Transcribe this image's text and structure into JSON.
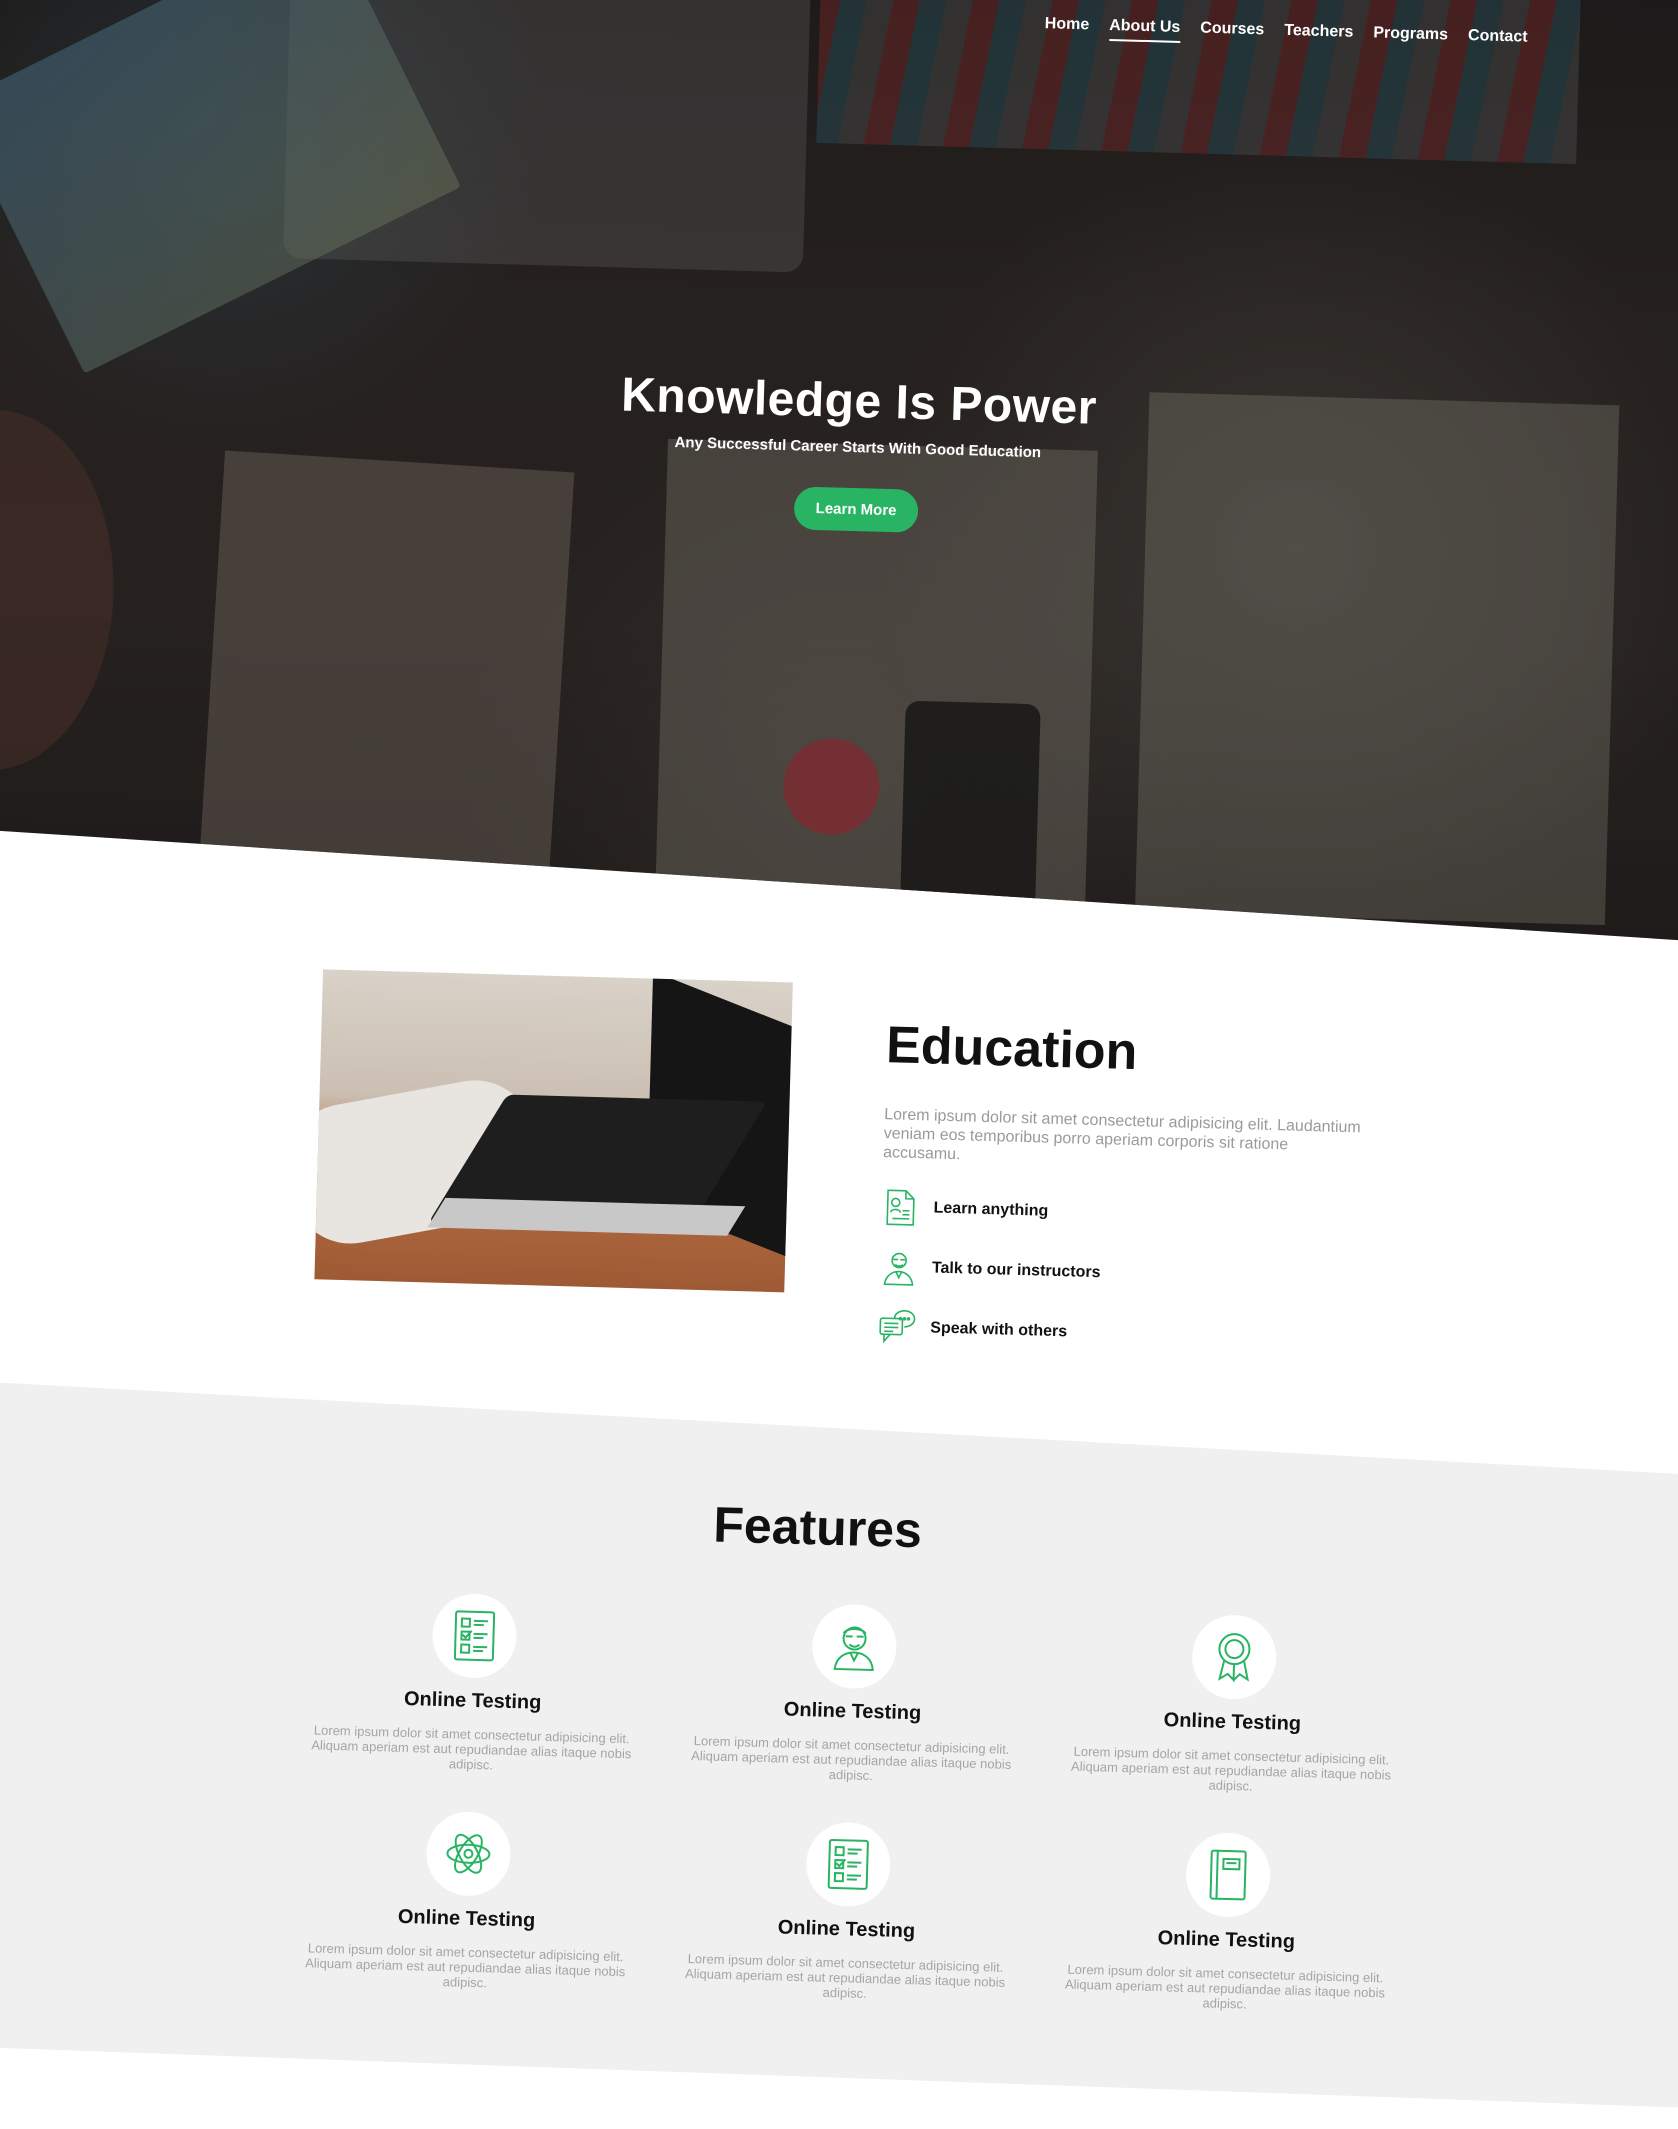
{
  "nav": {
    "items": [
      {
        "label": "Home"
      },
      {
        "label": "About Us",
        "active": true
      },
      {
        "label": "Courses"
      },
      {
        "label": "Teachers"
      },
      {
        "label": "Programs"
      },
      {
        "label": "Contact"
      }
    ]
  },
  "hero": {
    "title": "Knowledge Is Power",
    "subtitle": "Any Successful Career Starts With Good Education",
    "button_label": "Learn More"
  },
  "education": {
    "title": "Education",
    "description": "Lorem ipsum dolor sit amet consectetur adipisicing elit. Laudantium veniam eos temporibus porro aperiam corporis sit ratione accusamu.",
    "items": [
      {
        "icon": "resume-icon",
        "label": "Learn anything"
      },
      {
        "icon": "instructor-icon",
        "label": "Talk to our instructors"
      },
      {
        "icon": "chat-icon",
        "label": "Speak with others"
      }
    ]
  },
  "features": {
    "title": "Features",
    "items": [
      {
        "icon": "checklist-icon",
        "title": "Online Testing",
        "description": "Lorem ipsum dolor sit amet consectetur adipisicing elit. Aliquam aperiam est aut repudiandae alias itaque nobis adipisc."
      },
      {
        "icon": "teacher-icon",
        "title": "Online Testing",
        "description": "Lorem ipsum dolor sit amet consectetur adipisicing elit. Aliquam aperiam est aut repudiandae alias itaque nobis adipisc."
      },
      {
        "icon": "award-icon",
        "title": "Online Testing",
        "description": "Lorem ipsum dolor sit amet consectetur adipisicing elit. Aliquam aperiam est aut repudiandae alias itaque nobis adipisc."
      },
      {
        "icon": "atom-icon",
        "title": "Online Testing",
        "description": "Lorem ipsum dolor sit amet consectetur adipisicing elit. Aliquam aperiam est aut repudiandae alias itaque nobis adipisc."
      },
      {
        "icon": "checklist-icon",
        "title": "Online Testing",
        "description": "Lorem ipsum dolor sit amet consectetur adipisicing elit. Aliquam aperiam est aut repudiandae alias itaque nobis adipisc."
      },
      {
        "icon": "notebook-icon",
        "title": "Online Testing",
        "description": "Lorem ipsum dolor sit amet consectetur adipisicing elit. Aliquam aperiam est aut repudiandae alias itaque nobis adipisc."
      }
    ]
  },
  "colors": {
    "accent": "#28b463",
    "hero_text": "#ffffff",
    "features_bg": "#f0f0f0"
  }
}
